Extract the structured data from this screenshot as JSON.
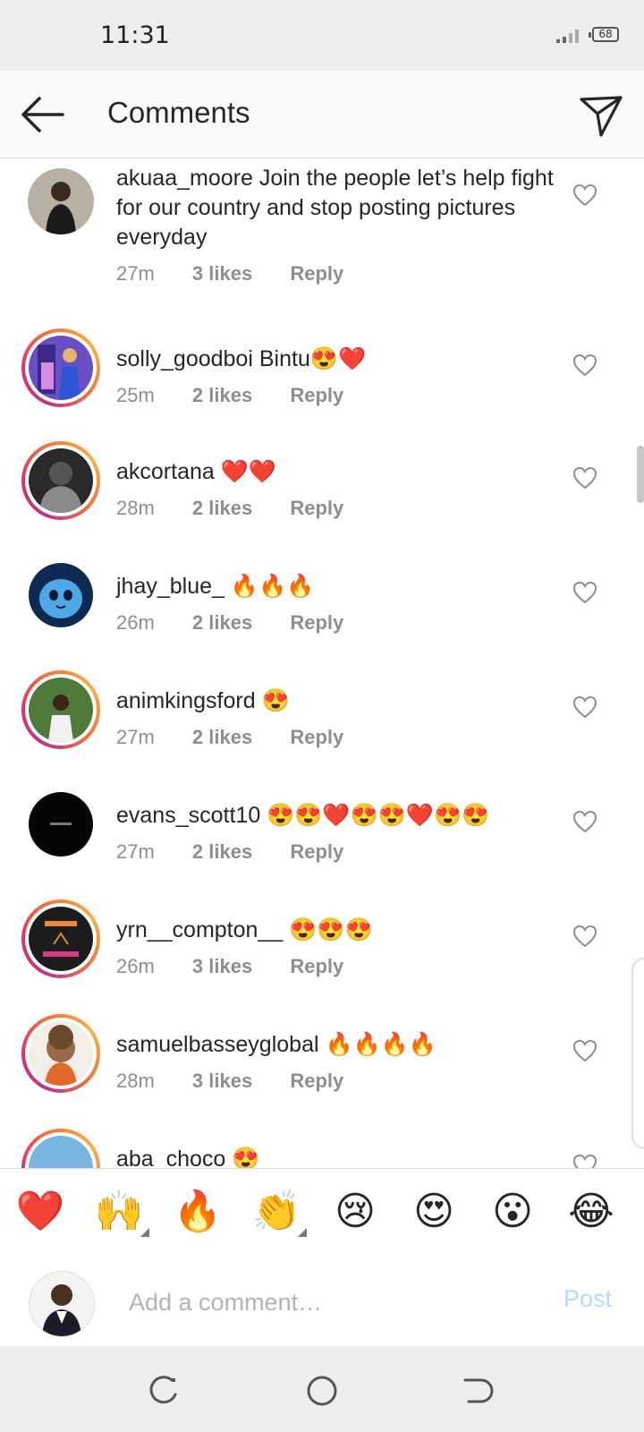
{
  "status_bar": {
    "time": "11:31",
    "battery": "68"
  },
  "header": {
    "title": "Comments"
  },
  "comments": [
    {
      "username": "akuaa_moore",
      "text": "Join the people let’s help fight for our country and stop posting pictures everyday",
      "time": "27m",
      "likes": "3 likes",
      "reply": "Reply"
    },
    {
      "username": "solly_goodboi",
      "text": "Bintu😍❤️",
      "time": "25m",
      "likes": "2 likes",
      "reply": "Reply"
    },
    {
      "username": "akcortana",
      "text": "❤️❤️",
      "time": "28m",
      "likes": "2 likes",
      "reply": "Reply"
    },
    {
      "username": "jhay_blue_",
      "text": "🔥🔥🔥",
      "time": "26m",
      "likes": "2 likes",
      "reply": "Reply"
    },
    {
      "username": "animkingsford",
      "text": "😍",
      "time": "27m",
      "likes": "2 likes",
      "reply": "Reply"
    },
    {
      "username": "evans_scott10",
      "text": "😍😍❤️😍😍❤️😍😍",
      "time": "27m",
      "likes": "2 likes",
      "reply": "Reply"
    },
    {
      "username": "yrn__compton__",
      "text": "😍😍😍",
      "time": "26m",
      "likes": "3 likes",
      "reply": "Reply"
    },
    {
      "username": "samuelbasseyglobal",
      "text": "🔥🔥🔥🔥",
      "time": "28m",
      "likes": "3 likes",
      "reply": "Reply"
    },
    {
      "username": "aba_choco",
      "text": "😍",
      "time": "",
      "likes": "",
      "reply": ""
    }
  ],
  "quick_emojis": [
    "❤️",
    "🙌",
    "🔥",
    "👏",
    "😢",
    "😍",
    "😮",
    "😂"
  ],
  "composer": {
    "placeholder": "Add a comment…",
    "post_label": "Post"
  },
  "colors": {
    "accent_disabled": "#b3dbff",
    "muted": "#8e8e8e",
    "like_heart": "#ed4956"
  }
}
